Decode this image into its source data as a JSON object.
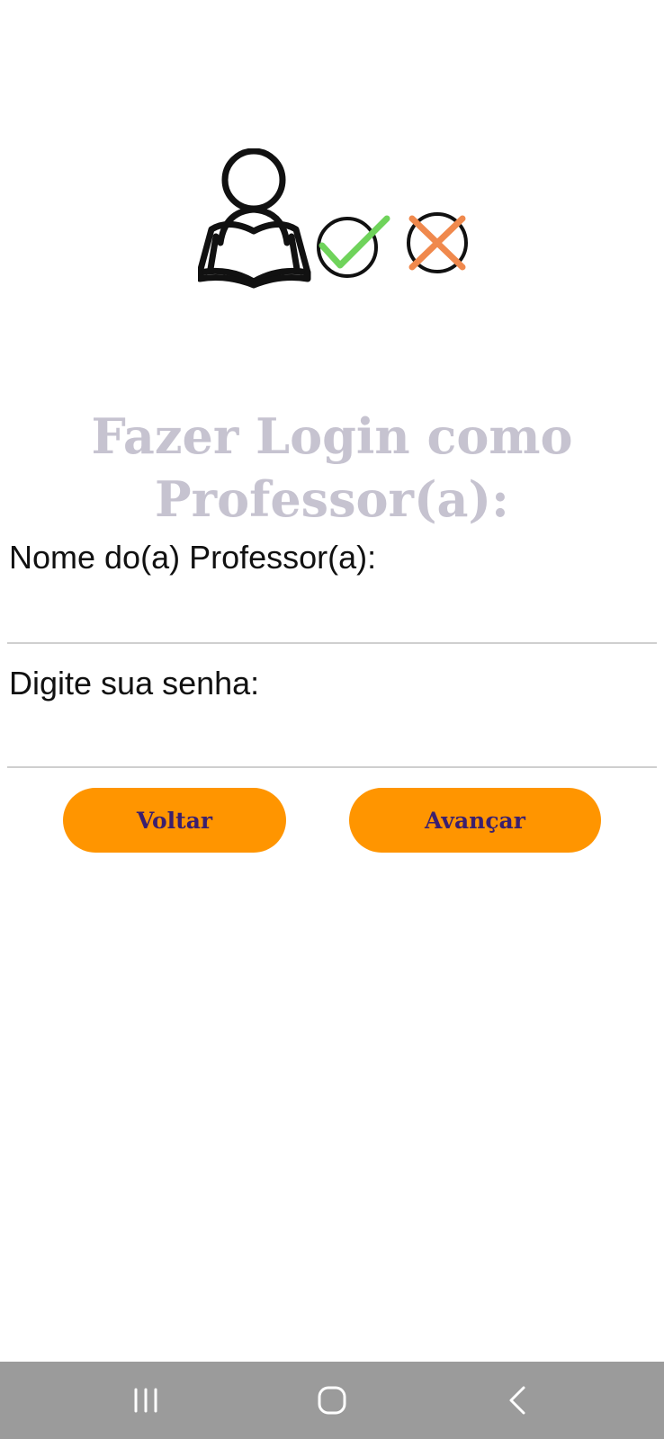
{
  "header": {
    "logo_icon": "teacher-reading-icon",
    "check_icon": "check-circle-icon",
    "cross_icon": "cross-circle-icon",
    "colors": {
      "check": "#6fd35b",
      "cross": "#f0894d",
      "outline": "#111111"
    }
  },
  "title": {
    "line1": "Fazer Login como",
    "line2": "Professor(a):"
  },
  "form": {
    "name_label": "Nome do(a) Professor(a):",
    "name_value": "",
    "password_label": "Digite sua senha:",
    "password_value": ""
  },
  "buttons": {
    "back_label": "Voltar",
    "next_label": "Avançar",
    "color": "#ff9500",
    "text_color": "#3b1f6e"
  },
  "navbar": {
    "recent_icon": "recent-apps-icon",
    "home_icon": "home-icon",
    "back_icon": "back-icon"
  }
}
